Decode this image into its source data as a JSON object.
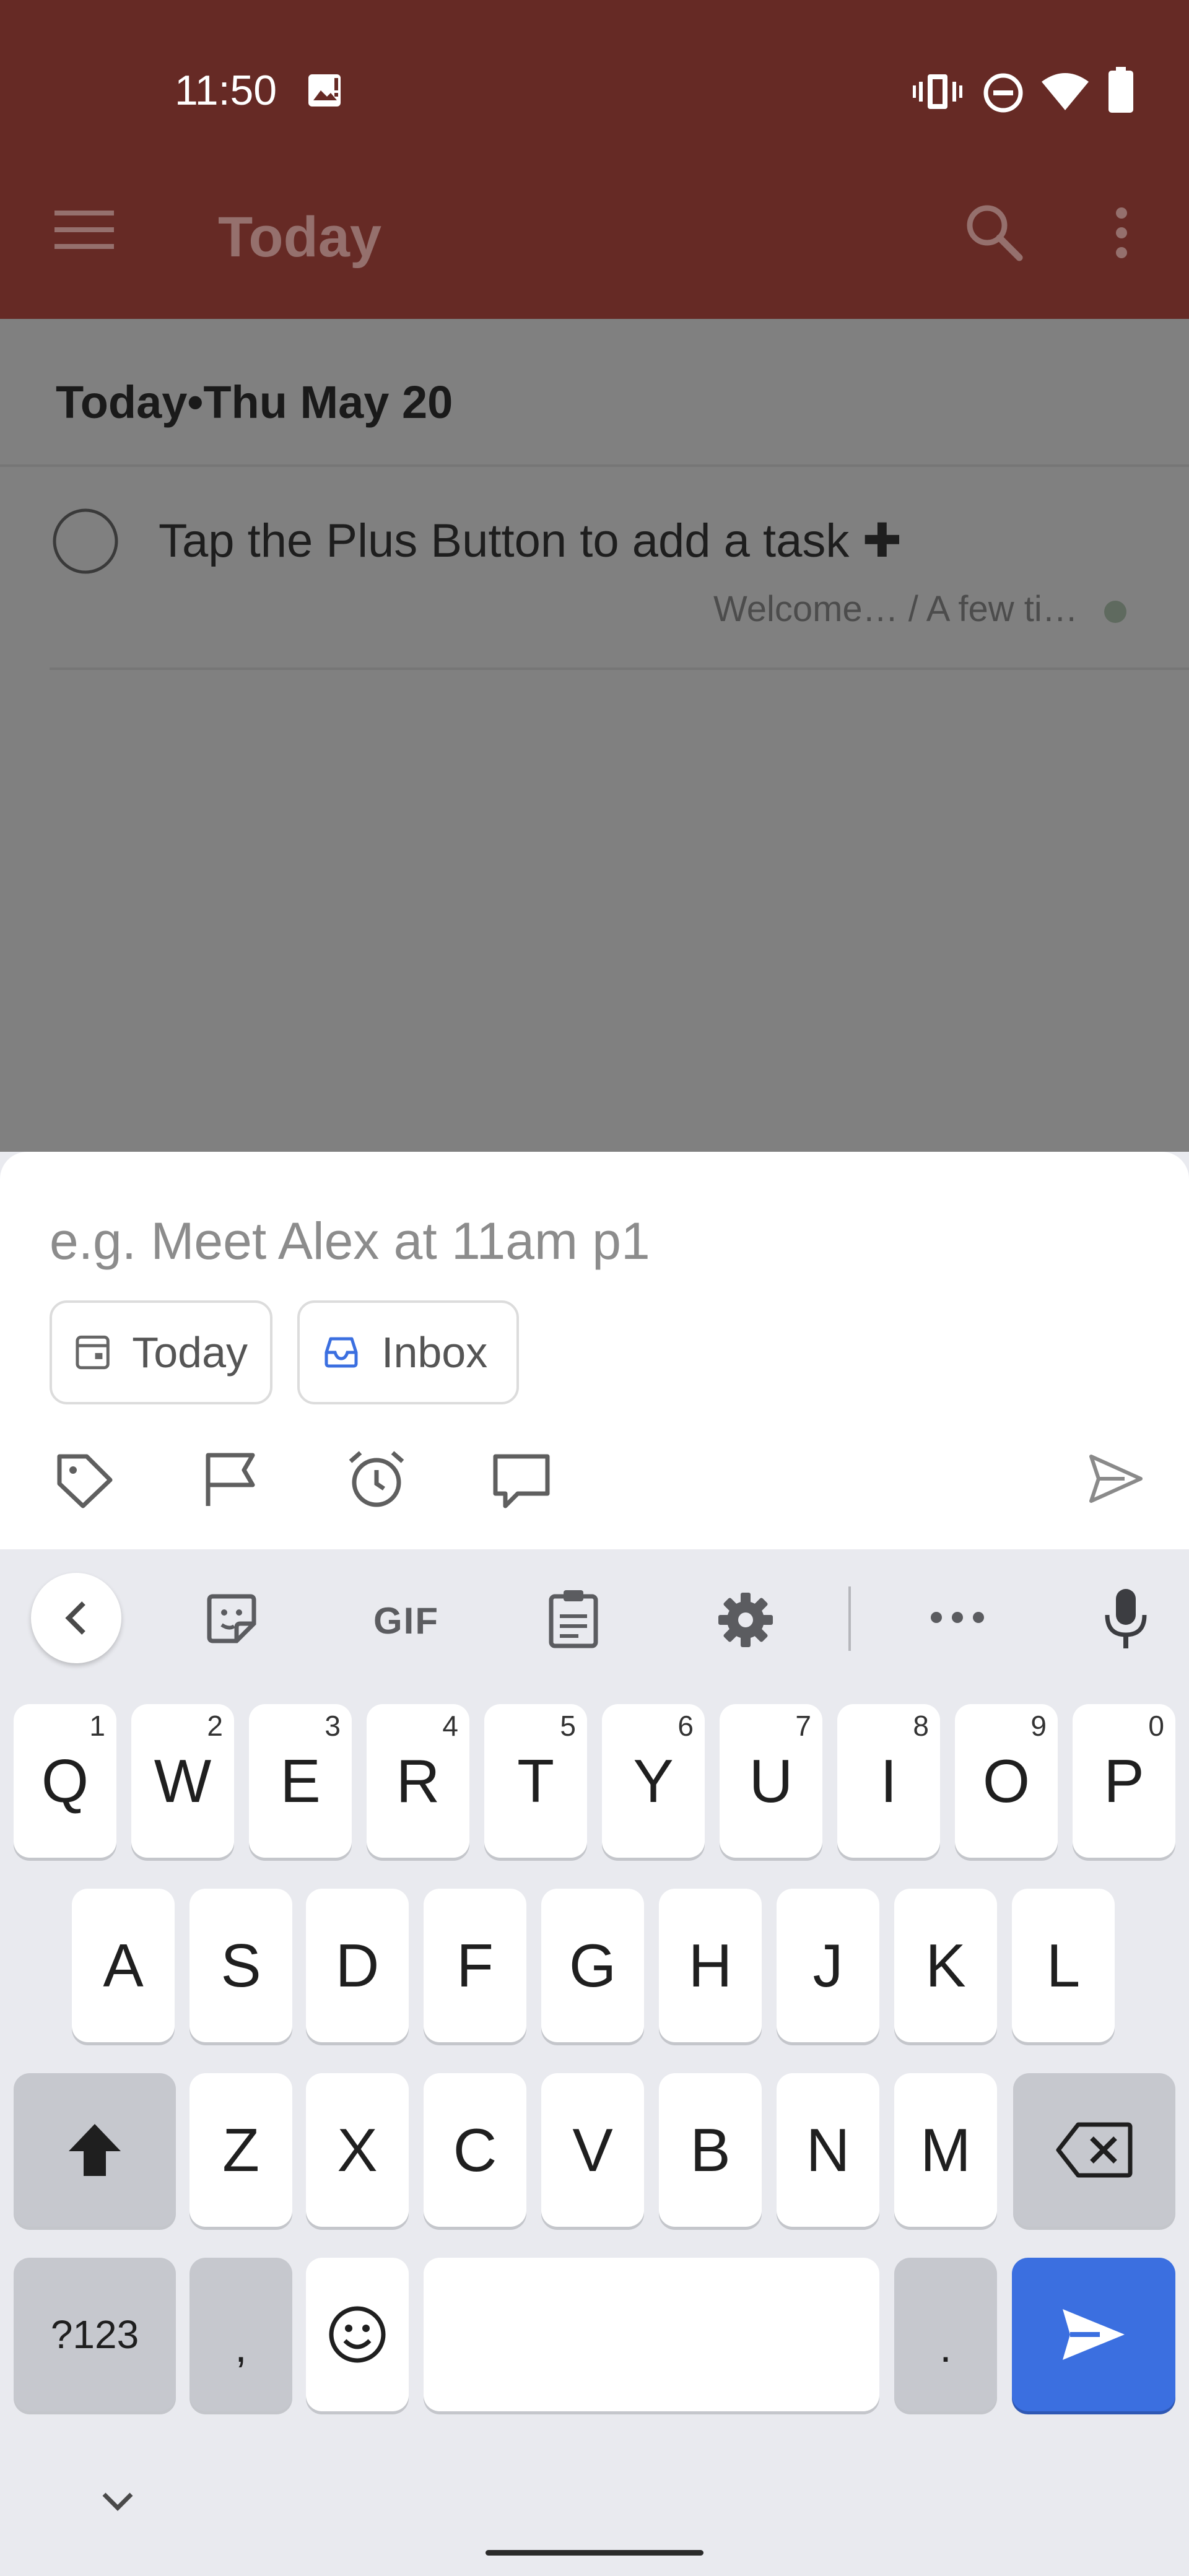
{
  "status_bar": {
    "time": "11:50"
  },
  "app_bar": {
    "title": "Today"
  },
  "section": {
    "header": "Today•Thu May 20"
  },
  "task": {
    "title": "Tap the Plus Button to add a task ✚",
    "meta": "Welcome… / A few ti…"
  },
  "quick_add": {
    "placeholder": "e.g. Meet Alex at 11am p1",
    "chips": {
      "date": "Today",
      "project": "Inbox"
    }
  },
  "keyboard": {
    "toolbar": {
      "gif": "GIF"
    },
    "rows": {
      "top": [
        {
          "key": "Q",
          "hint": "1"
        },
        {
          "key": "W",
          "hint": "2"
        },
        {
          "key": "E",
          "hint": "3"
        },
        {
          "key": "R",
          "hint": "4"
        },
        {
          "key": "T",
          "hint": "5"
        },
        {
          "key": "Y",
          "hint": "6"
        },
        {
          "key": "U",
          "hint": "7"
        },
        {
          "key": "I",
          "hint": "8"
        },
        {
          "key": "O",
          "hint": "9"
        },
        {
          "key": "P",
          "hint": "0"
        }
      ],
      "middle": [
        "A",
        "S",
        "D",
        "F",
        "G",
        "H",
        "J",
        "K",
        "L"
      ],
      "bottom": [
        "Z",
        "X",
        "C",
        "V",
        "B",
        "N",
        "M"
      ]
    },
    "symbols_key": "?123",
    "comma_key": ",",
    "period_key": "."
  },
  "colors": {
    "app_bar": "#662a25",
    "overlay_content": "#808080",
    "accent_blue": "#3b6fe0",
    "keyboard_bg": "#e9eaef"
  }
}
